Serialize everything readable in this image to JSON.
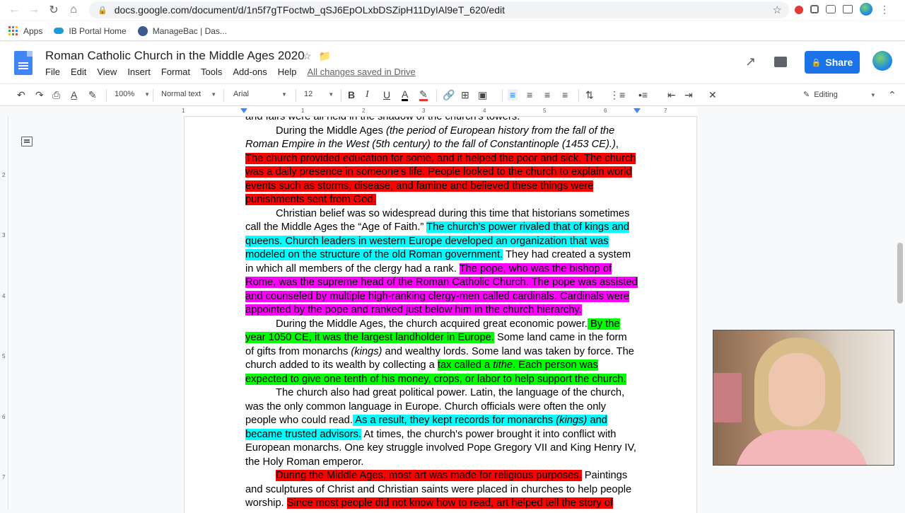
{
  "browser": {
    "url": "docs.google.com/document/d/1n5f7gTFoctwb_qSJ6EpOLxbDSZipH11DyIAl9eT_620/edit",
    "bookmarks": [
      "Apps",
      "IB Portal Home",
      "ManageBac | Das..."
    ]
  },
  "docs": {
    "title": "Roman Catholic Church in the Middle Ages 2020",
    "menu": [
      "File",
      "Edit",
      "View",
      "Insert",
      "Format",
      "Tools",
      "Add-ons",
      "Help"
    ],
    "saved_status": "All changes saved in Drive",
    "share_label": "Share"
  },
  "toolbar": {
    "zoom": "100%",
    "style": "Normal text",
    "font": "Arial",
    "size": "12",
    "mode": "Editing"
  },
  "ruler": {
    "numbers": [
      "1",
      "1",
      "2",
      "3",
      "4",
      "5",
      "6",
      "7"
    ]
  },
  "vruler": {
    "numbers": [
      "2",
      "3",
      "4",
      "5",
      "6",
      "7"
    ]
  },
  "colors": {
    "red": "#ff0000",
    "cyan": "#00ffff",
    "magenta": "#ff00ff",
    "green": "#00ff00",
    "share": "#1a73e8"
  },
  "doc": {
    "p0": "and fairs were all held in the shadow of the church's towers.",
    "p1a": "During the Middle Ages ",
    "p1b": "(the period of European history from the fall of the Roman Empire in the West (5th century) to the fall of Constantinople (1453 CE).)",
    "p1c": ", ",
    "p1d": "The church provided education for some, and it helped the poor and sick. The church was a daily presence in someone's life. People looked to the church to explain world events such as storms, disease, and famine and believed these things were punishments sent from God.",
    "p2a": "Christian belief was so widespread during this time that historians sometimes call the Middle Ages the “Age of Faith.” ",
    "p2b": "The church's power rivaled that of kings and queens. Church leaders in western Europe developed an organization that was modeled on the structure of the old Roman government.",
    "p2c": " They had created a system in which all members of the clergy had a rank. ",
    "p2d": "The pope, who was the bishop of Rome, was the supreme head of the Roman Catholic Church. The pope was assisted and counseled by multiple high-ranking clergy-men called cardinals. Cardinals were appointed by the pope and ranked just below him in the church hierarchy.",
    "p3a": "During the Middle Ages, the church acquired great economic power.",
    "p3b": " By the year 1050 CE, it was the largest landholder in Europe.",
    "p3c": " Some land came in the form of gifts from monarchs ",
    "p3d": "(kings)",
    "p3e": " and wealthy lords. Some land was taken by force. The church added to its wealth by collecting a ",
    "p3f": "tax called a ",
    "p3g": "tithe",
    "p3h": ". Each person was expected to give one tenth of his money, crops, or labor to help support the church.",
    "p4a": "The church also had great political power. Latin, the language of the church, was the only common language in Europe. Church officials were often the only people who could read.",
    "p4b": " As a result, they kept records for monarchs ",
    "p4c": "(kings)",
    "p4d": " and became trusted advisors.",
    "p4e": " At times, the church's power brought it into conflict with European monarchs. One key struggle involved Pope Gregory VII and King Henry IV, the Holy Roman emperor.",
    "p5a": "During the Middle Ages, most art was made for religious purposes.",
    "p5b": " Paintings and sculptures of Christ and Christian saints were placed in churches to help people worship. ",
    "p5c": "Since most people did not know how to read, art helped tell the story of"
  }
}
